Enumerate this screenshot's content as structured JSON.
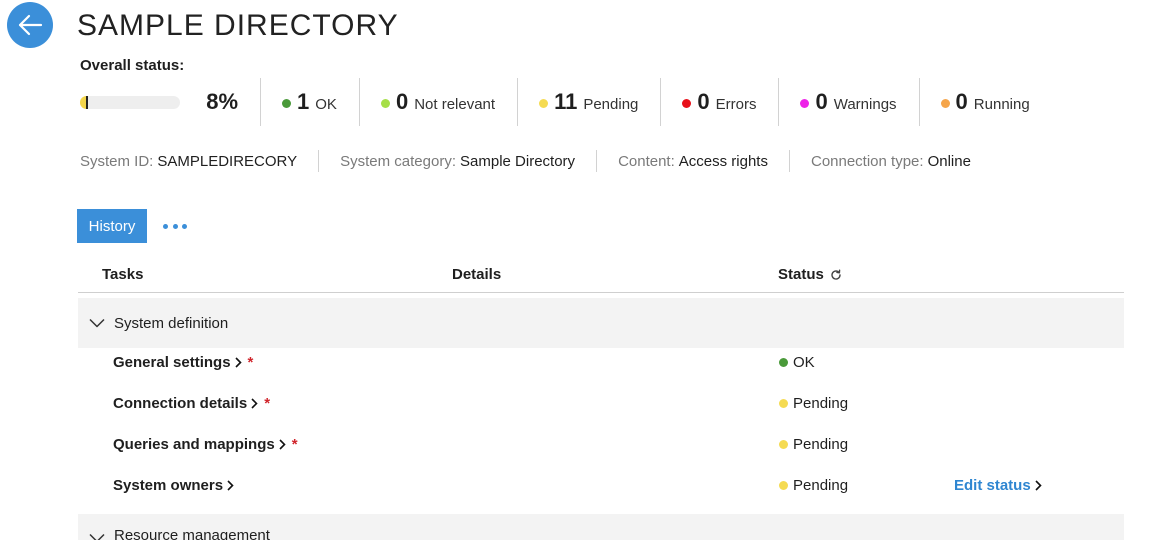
{
  "header": {
    "title": "SAMPLE DIRECTORY",
    "back_icon": "arrow-left-icon"
  },
  "overall_status": {
    "label": "Overall status:",
    "progress_fraction": 0.08,
    "percent_text": "8%",
    "stats": [
      {
        "count": "1",
        "label": "OK",
        "color": "#4a9a3a"
      },
      {
        "count": "0",
        "label": "Not relevant",
        "color": "#a6df48"
      },
      {
        "count": "11",
        "label": "Pending",
        "color": "#f5db52"
      },
      {
        "count": "0",
        "label": "Errors",
        "color": "#e8101a"
      },
      {
        "count": "0",
        "label": "Warnings",
        "color": "#ee22e8"
      },
      {
        "count": "0",
        "label": "Running",
        "color": "#f5a54a"
      }
    ]
  },
  "meta": [
    {
      "key": "System ID:",
      "value": "SAMPLEDIRECORY"
    },
    {
      "key": "System category:",
      "value": "Sample Directory"
    },
    {
      "key": "Content:",
      "value": "Access rights"
    },
    {
      "key": "Connection type:",
      "value": "Online"
    }
  ],
  "toolbar": {
    "history_label": "History",
    "more_icon": "more-horizontal-icon"
  },
  "table": {
    "columns": {
      "tasks": "Tasks",
      "details": "Details",
      "status": "Status"
    },
    "refresh_icon": "refresh-icon",
    "groups": [
      {
        "title": "System definition",
        "tasks": [
          {
            "name": "General settings",
            "required": "*",
            "status": "OK",
            "status_color": "#4a9a3a"
          },
          {
            "name": "Connection details",
            "required": "*",
            "status": "Pending",
            "status_color": "#f5db52"
          },
          {
            "name": "Queries and mappings",
            "required": "*",
            "status": "Pending",
            "status_color": "#f5db52"
          },
          {
            "name": "System owners",
            "required": "",
            "status": "Pending",
            "status_color": "#f5db52",
            "action": "Edit status"
          }
        ]
      },
      {
        "title": "Resource management",
        "tasks": []
      }
    ]
  },
  "colors": {
    "accent": "#3b8fd9",
    "link": "#2f86d1",
    "required": "#d0242b",
    "group_bg": "#f3f3f3"
  }
}
